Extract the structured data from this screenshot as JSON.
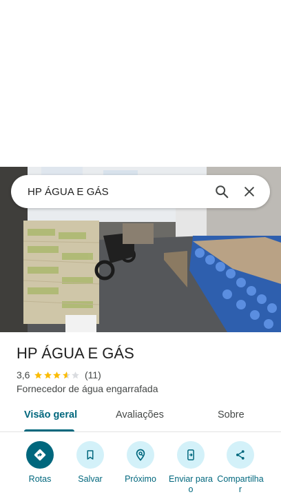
{
  "search": {
    "query": "HP ÁGUA E GÁS",
    "search_icon": "search-icon",
    "close_icon": "close-icon"
  },
  "place": {
    "name": "HP ÁGUA E GÁS",
    "rating": "3,6",
    "rating_value": 3.6,
    "review_count": "(11)",
    "category": "Fornecedor de água engarrafada"
  },
  "tabs": [
    {
      "label": "Visão geral",
      "active": true
    },
    {
      "label": "Avaliações",
      "active": false
    },
    {
      "label": "Sobre",
      "active": false
    }
  ],
  "actions": [
    {
      "label": "Rotas",
      "icon": "directions-icon"
    },
    {
      "label": "Salvar",
      "icon": "bookmark-icon"
    },
    {
      "label": "Próximo",
      "icon": "nearby-icon"
    },
    {
      "label": "Enviar para o",
      "icon": "send-to-phone-icon"
    },
    {
      "label": "Compartilhar",
      "icon": "share-icon"
    }
  ],
  "colors": {
    "accent": "#00677d",
    "accent_light": "#d3f1f9",
    "star": "#fbbc04",
    "star_empty": "#dadce0"
  }
}
